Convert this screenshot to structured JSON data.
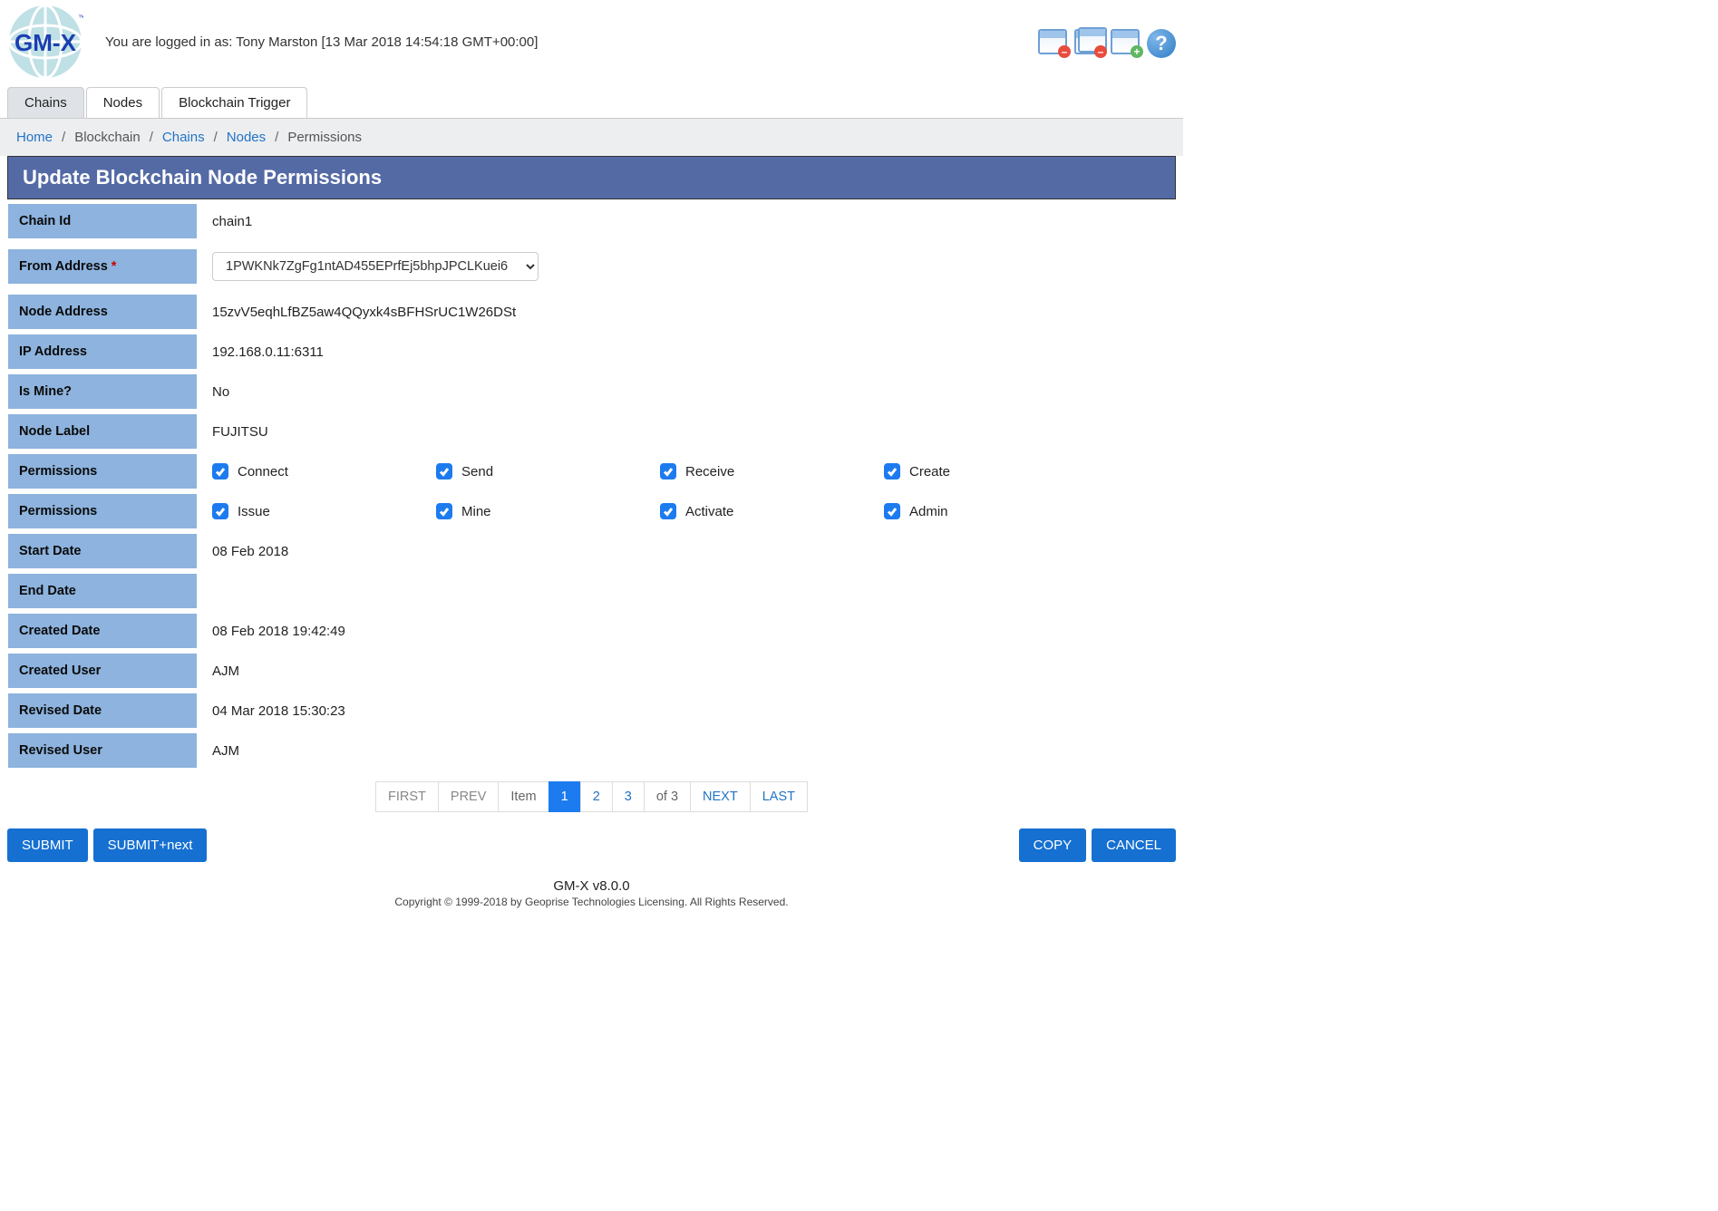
{
  "header": {
    "login_msg": "You are logged in as: Tony Marston [13 Mar 2018 14:54:18 GMT+00:00]"
  },
  "tabs": [
    {
      "label": "Chains",
      "active": true
    },
    {
      "label": "Nodes",
      "active": false
    },
    {
      "label": "Blockchain Trigger",
      "active": false
    }
  ],
  "breadcrumbs": [
    {
      "label": "Home",
      "link": true
    },
    {
      "label": "Blockchain",
      "link": false
    },
    {
      "label": "Chains",
      "link": true
    },
    {
      "label": "Nodes",
      "link": true
    },
    {
      "label": "Permissions",
      "link": false
    }
  ],
  "page_title": "Update Blockchain Node Permissions",
  "form": {
    "chain_id": {
      "label": "Chain Id",
      "value": "chain1"
    },
    "from_address": {
      "label": "From Address",
      "required": true,
      "value": "1PWKNk7ZgFg1ntAD455EPrfEj5bhpJPCLKuei6"
    },
    "node_address": {
      "label": "Node Address",
      "value": "15zvV5eqhLfBZ5aw4QQyxk4sBFHSrUC1W26DSt"
    },
    "ip_address": {
      "label": "IP Address",
      "value": "192.168.0.11:6311"
    },
    "is_mine": {
      "label": "Is Mine?",
      "value": "No"
    },
    "node_label": {
      "label": "Node Label",
      "value": "FUJITSU"
    },
    "perm1": {
      "label": "Permissions",
      "items": [
        {
          "label": "Connect",
          "checked": true
        },
        {
          "label": "Send",
          "checked": true
        },
        {
          "label": "Receive",
          "checked": true
        },
        {
          "label": "Create",
          "checked": true
        }
      ]
    },
    "perm2": {
      "label": "Permissions",
      "items": [
        {
          "label": "Issue",
          "checked": true
        },
        {
          "label": "Mine",
          "checked": true
        },
        {
          "label": "Activate",
          "checked": true
        },
        {
          "label": "Admin",
          "checked": true
        }
      ]
    },
    "start_date": {
      "label": "Start Date",
      "value": "08 Feb 2018"
    },
    "end_date": {
      "label": "End Date",
      "value": ""
    },
    "created_date": {
      "label": "Created Date",
      "value": "08 Feb 2018 19:42:49"
    },
    "created_user": {
      "label": "Created User",
      "value": "AJM"
    },
    "revised_date": {
      "label": "Revised Date",
      "value": "04 Mar 2018 15:30:23"
    },
    "revised_user": {
      "label": "Revised User",
      "value": "AJM"
    }
  },
  "pager": {
    "first": "FIRST",
    "prev": "PREV",
    "item": "Item",
    "pages": [
      "1",
      "2",
      "3"
    ],
    "current": "1",
    "of_total": "of 3",
    "next": "NEXT",
    "last": "LAST"
  },
  "actions": {
    "submit": "SUBMIT",
    "submit_next": "SUBMIT+next",
    "copy": "COPY",
    "cancel": "CANCEL"
  },
  "footer": {
    "version": "GM-X v8.0.0",
    "copyright": "Copyright © 1999-2018 by Geoprise Technologies Licensing. All Rights Reserved."
  }
}
